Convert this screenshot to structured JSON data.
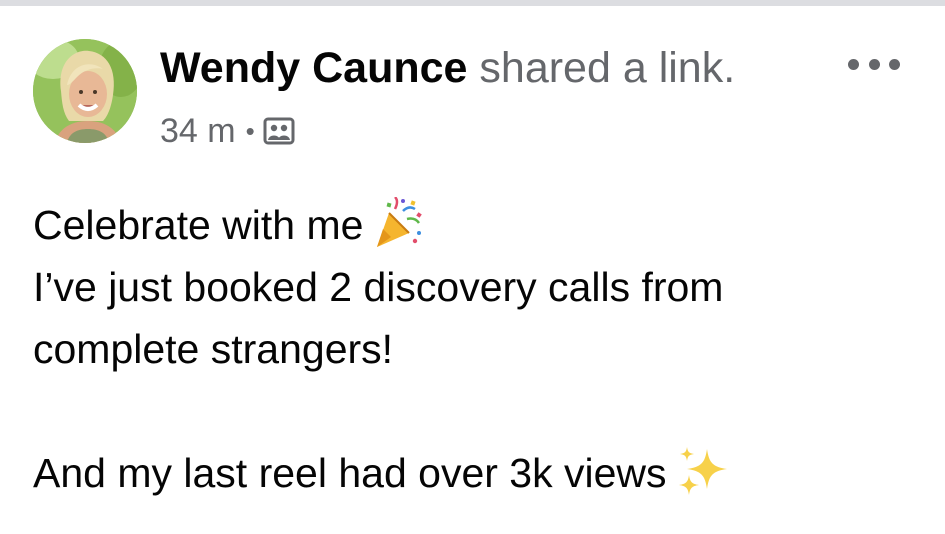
{
  "post": {
    "author": "Wendy Caunce",
    "action": "shared a link.",
    "timestamp": "34 m",
    "separator": "•",
    "audience_icon": "friends-group-icon",
    "more_icon": "more-options-icon",
    "body": {
      "line1": "Celebrate with me",
      "line1_emoji": "party-popper-icon",
      "line2": "I’ve just booked 2 discovery calls from",
      "line3": "complete strangers!",
      "line5": "And my last reel had over 3k views",
      "line5_emoji": "sparkles-icon"
    }
  },
  "colors": {
    "primary_text": "#050505",
    "secondary_text": "#65676b",
    "background": "#ffffff",
    "top_rule": "#dcdde1"
  }
}
